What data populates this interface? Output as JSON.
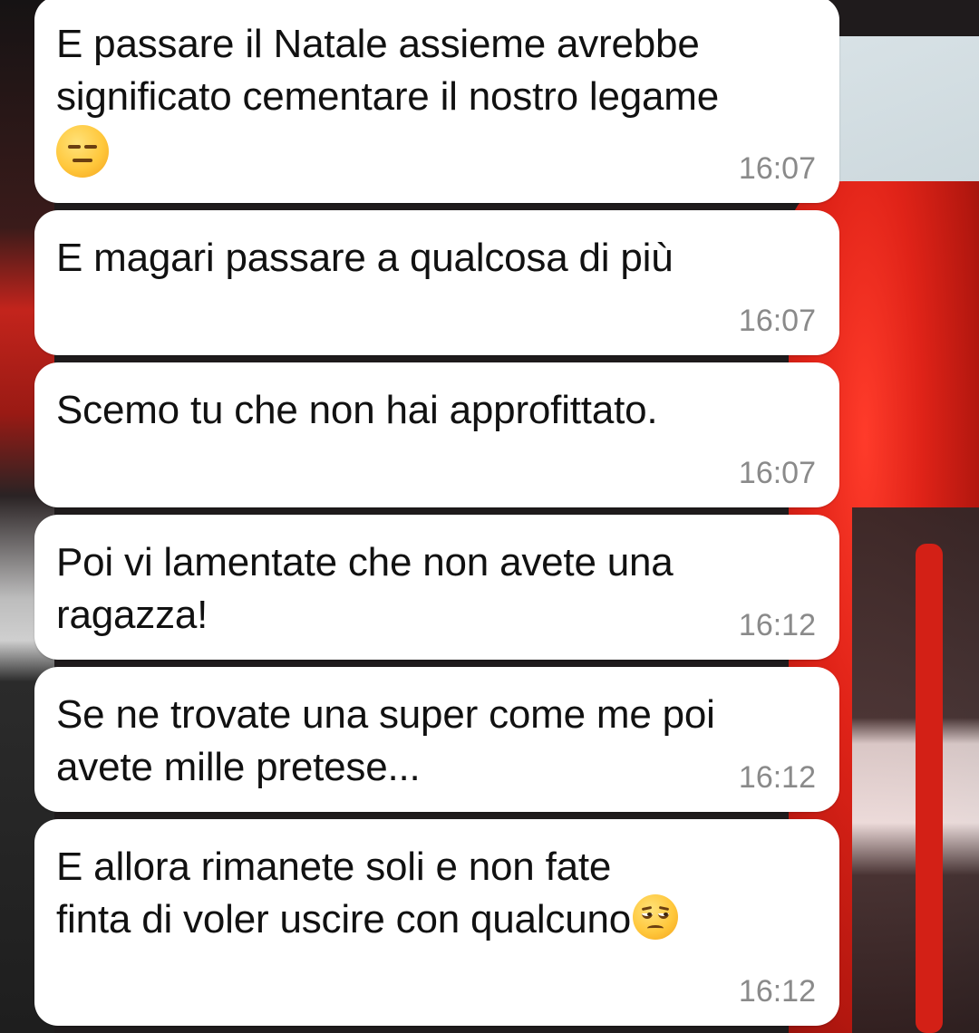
{
  "chat": {
    "messages": [
      {
        "text": "E passare il Natale assieme avrebbe\nsignificato cementare il nostro legame",
        "emoji": "expressionless-face-emoji",
        "time": "16:07"
      },
      {
        "text": "E magari passare a qualcosa di più",
        "time": "16:07"
      },
      {
        "text": "Scemo tu che non hai approfittato.",
        "time": "16:07"
      },
      {
        "text": "Poi vi lamentate che non avete una\nragazza!",
        "time": "16:12"
      },
      {
        "text": "Se ne trovate una super come me poi\navete mille pretese...",
        "time": "16:12"
      },
      {
        "text_line1": "E allora rimanete soli e non fate",
        "text_line2": "finta di voler uscire con qualcuno",
        "emoji": "unamused-face-emoji",
        "time": "16:12"
      }
    ]
  },
  "colors": {
    "bubble": "#ffffff",
    "text": "#111111",
    "timestamp": "#8a8a8a",
    "wallpaper_accent": "#e02318"
  }
}
